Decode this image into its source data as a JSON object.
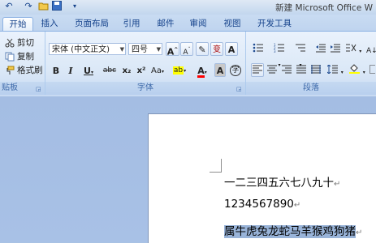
{
  "title": {
    "text": "新建 Microsoft Office W"
  },
  "tabs": [
    {
      "label": "开始",
      "active": true
    },
    {
      "label": "插入"
    },
    {
      "label": "页面布局"
    },
    {
      "label": "引用"
    },
    {
      "label": "邮件"
    },
    {
      "label": "审阅"
    },
    {
      "label": "视图"
    },
    {
      "label": "开发工具"
    }
  ],
  "clipboard": {
    "cut": "剪切",
    "copy": "复制",
    "format_painter": "格式刷",
    "label": "贴板"
  },
  "font": {
    "name": "宋体 (中文正文)",
    "size": "四号",
    "label": "字体",
    "bold": "B",
    "italic": "I",
    "underline": "U",
    "strike": "abc",
    "subscript": "x₂",
    "superscript": "x²",
    "change_case": "Aa",
    "grow": "A",
    "shrink": "A",
    "clear": "✎",
    "phonetic": "变",
    "border_char": "A",
    "font_color": "A",
    "shading": "A",
    "enclose": "字",
    "highlight": "ab"
  },
  "paragraph": {
    "label": "段落"
  },
  "document": {
    "lines": [
      {
        "text": "一二三四五六七八九十"
      },
      {
        "text": "1234567890"
      },
      {
        "text": "属牛虎兔龙蛇马羊猴鸡狗猪"
      }
    ]
  },
  "colors": {
    "highlight": "#ffff00",
    "font_color": "#ff0000",
    "selection": "#99b4d9"
  }
}
